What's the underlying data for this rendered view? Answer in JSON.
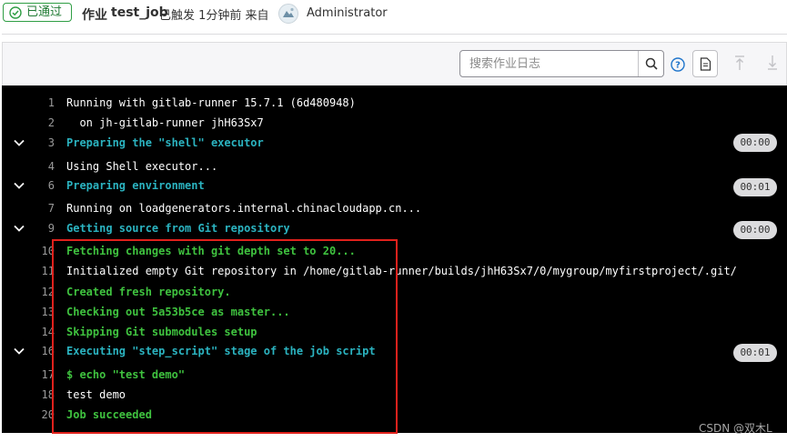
{
  "header": {
    "status_badge": "已通过",
    "job_word": "作业",
    "job_name": "test_job",
    "triggered_text": "已触发 1分钟前 来自",
    "username": "Administrator"
  },
  "toolbar": {
    "search_placeholder": "搜索作业日志"
  },
  "log_lines": [
    {
      "num": "1",
      "text": "Running with gitlab-runner 15.7.1 (6d480948)",
      "style": "plain"
    },
    {
      "num": "2",
      "text": "  on jh-gitlab-runner jhH63Sx7",
      "style": "plain"
    },
    {
      "num": "3",
      "text": "Preparing the \"shell\" executor",
      "style": "cyan",
      "collapsible": true,
      "duration": "00:00"
    },
    {
      "num": "4",
      "text": "Using Shell executor...",
      "style": "plain"
    },
    {
      "num": "6",
      "text": "Preparing environment",
      "style": "cyan",
      "collapsible": true,
      "duration": "00:01"
    },
    {
      "num": "7",
      "text": "Running on loadgenerators.internal.chinacloudapp.cn...",
      "style": "plain"
    },
    {
      "num": "9",
      "text": "Getting source from Git repository",
      "style": "cyan",
      "collapsible": true,
      "duration": "00:00"
    },
    {
      "num": "10",
      "text": "Fetching changes with git depth set to 20...",
      "style": "green"
    },
    {
      "num": "11",
      "text": "Initialized empty Git repository in /home/gitlab-runner/builds/jhH63Sx7/0/mygroup/myfirstproject/.git/",
      "style": "plain"
    },
    {
      "num": "12",
      "text": "Created fresh repository.",
      "style": "green"
    },
    {
      "num": "13",
      "text": "Checking out 5a53b5ce as master...",
      "style": "green"
    },
    {
      "num": "14",
      "text": "Skipping Git submodules setup",
      "style": "green"
    },
    {
      "num": "16",
      "text": "Executing \"step_script\" stage of the job script",
      "style": "cyan",
      "collapsible": true,
      "duration": "00:01"
    },
    {
      "num": "17",
      "text": "$ echo \"test demo\"",
      "style": "green"
    },
    {
      "num": "18",
      "text": "test demo",
      "style": "plain"
    },
    {
      "num": "20",
      "text": "Job succeeded",
      "style": "green"
    }
  ],
  "watermark": "CSDN @双木L",
  "colors": {
    "log_background": "#000000",
    "section_header": "#2bb3c0",
    "success_text": "#3fc23f",
    "highlight_border": "#e0211c",
    "passed_badge": "#2f9e44"
  }
}
